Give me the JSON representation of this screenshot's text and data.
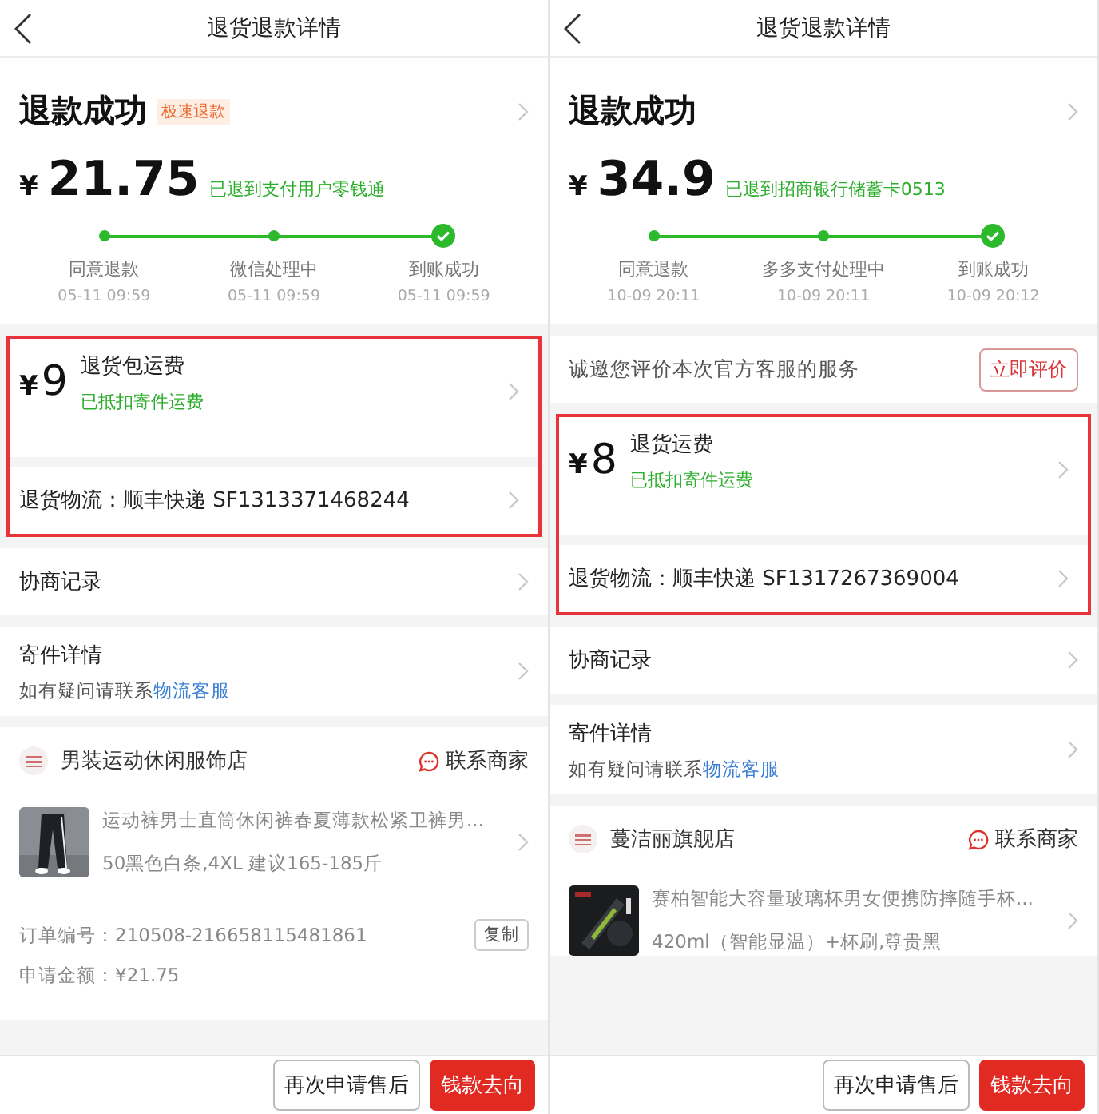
{
  "screens": [
    {
      "title": "退货退款详情",
      "status": {
        "title": "退款成功",
        "badge": "极速退款",
        "currency": "¥",
        "amount": "21.75",
        "note": "已退到支付用户零钱通"
      },
      "steps": [
        {
          "label": "同意退款",
          "time": "05-11 09:59",
          "kind": "dot"
        },
        {
          "label": "微信处理中",
          "time": "05-11 09:59",
          "kind": "dot"
        },
        {
          "label": "到账成功",
          "time": "05-11 09:59",
          "kind": "check"
        }
      ],
      "fee": {
        "currency": "¥",
        "amount": "9",
        "label": "退货包运费",
        "note": "已抵扣寄件运费"
      },
      "logistics": "退货物流：顺丰快递 SF1313371468244",
      "negotiation": "协商记录",
      "shipping": {
        "title": "寄件详情",
        "hint": "如有疑问请联系",
        "link": "物流客服"
      },
      "store": {
        "name": "男装运动休闲服饰店",
        "contact": "联系商家"
      },
      "product": {
        "title": "运动裤男士直筒休闲裤春夏薄款松紧卫裤男...",
        "spec": "50黑色白条,4XL 建议165-185斤",
        "kind": "trousers"
      },
      "order": [
        {
          "label": "订单编号：",
          "value": "210508-216658115481861",
          "action": "复制"
        },
        {
          "label": "申请金额：",
          "value": "¥21.75"
        }
      ],
      "buttons": [
        {
          "label": "再次申请售后",
          "kind": "outline"
        },
        {
          "label": "钱款去向",
          "kind": "primary"
        }
      ]
    },
    {
      "title": "退货退款详情",
      "status": {
        "title": "退款成功",
        "currency": "¥",
        "amount": "34.9",
        "note": "已退到招商银行储蓄卡0513"
      },
      "steps": [
        {
          "label": "同意退款",
          "time": "10-09 20:11",
          "kind": "dot"
        },
        {
          "label": "多多支付处理中",
          "time": "10-09 20:11",
          "kind": "dot"
        },
        {
          "label": "到账成功",
          "time": "10-09 20:12",
          "kind": "check"
        }
      ],
      "rating": {
        "text": "诚邀您评价本次官方客服的服务",
        "button": "立即评价"
      },
      "fee": {
        "currency": "¥",
        "amount": "8",
        "label": "退货运费",
        "note": "已抵扣寄件运费"
      },
      "logistics": "退货物流：顺丰快递 SF1317267369004",
      "negotiation": "协商记录",
      "shipping": {
        "title": "寄件详情",
        "hint": "如有疑问请联系",
        "link": "物流客服"
      },
      "store": {
        "name": "蔓洁丽旗舰店",
        "contact": "联系商家"
      },
      "product": {
        "title": "赛柏智能大容量玻璃杯男女便携防摔随手杯...",
        "spec": "420ml（智能显温）+杯刷,尊贵黑",
        "kind": "bottle"
      },
      "buttons": [
        {
          "label": "再次申请售后",
          "kind": "outline"
        },
        {
          "label": "钱款去向",
          "kind": "primary"
        }
      ]
    }
  ]
}
